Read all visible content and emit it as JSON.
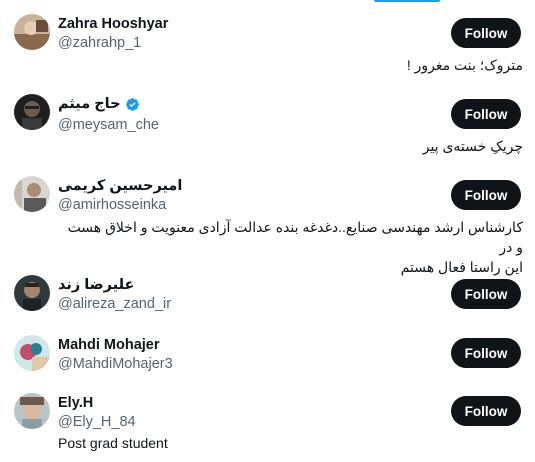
{
  "follow_label": "Follow",
  "accent_color": "#1d9bf0",
  "users": [
    {
      "name": "Zahra Hooshyar",
      "handle": "@zahrahp_1",
      "bio": "متروک؛ بنت مغرور !",
      "verified": false
    },
    {
      "name": "حاج میثم",
      "handle": "@meysam_che",
      "bio": "چریکِ خسته‌ی پیر",
      "verified": true
    },
    {
      "name": "امیرحسین کریمی",
      "handle": "@amirhosseinka",
      "bio_lines": [
        "کارشناس ارشد مهندسی صنایع..دغدغه بنده عدالت آزادی معنویت و اخلاق هست و در",
        "این راستا فعال هستم"
      ],
      "verified": false
    },
    {
      "name": "علیرضا زند",
      "handle": "@alireza_zand_ir",
      "verified": false
    },
    {
      "name": "Mahdi Mohajer",
      "handle": "@MahdiMohajer3",
      "verified": false
    },
    {
      "name": "Ely.H",
      "handle": "@Ely_H_84",
      "bio": "Post grad student",
      "verified": false
    }
  ]
}
